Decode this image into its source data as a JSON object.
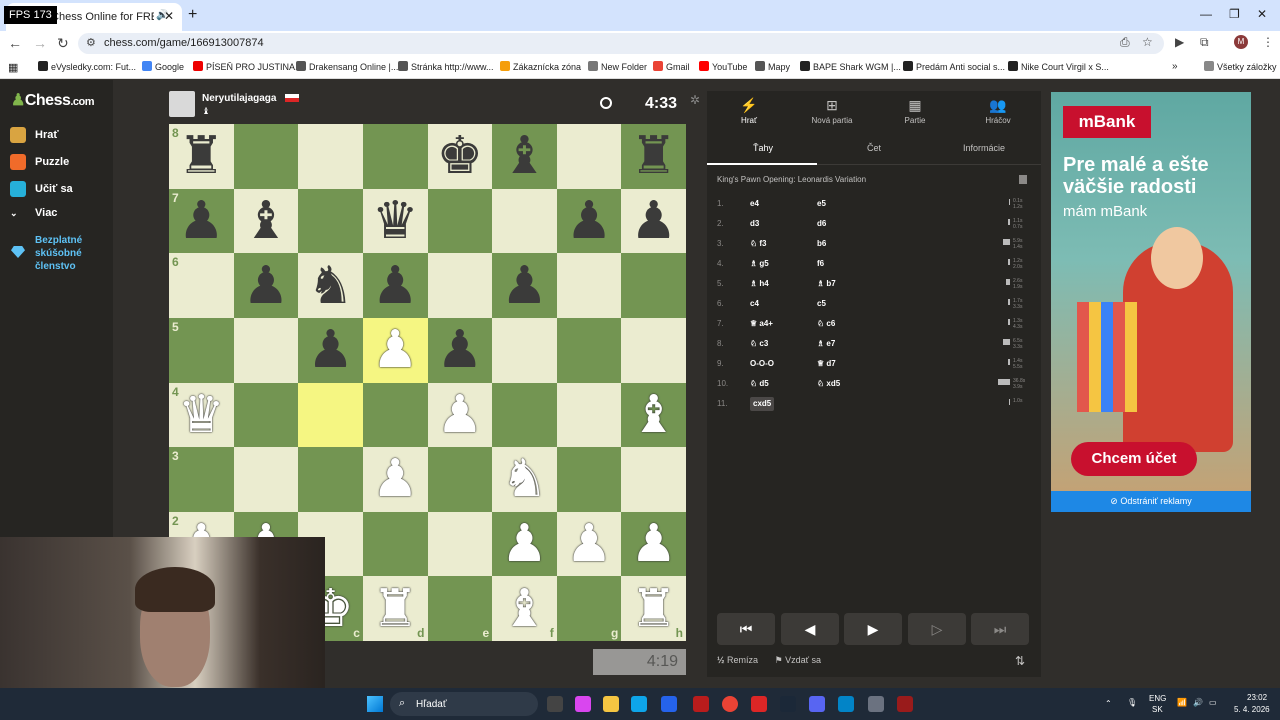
{
  "fps": "FPS 173",
  "browser": {
    "tab_title": "lay Chess Online for FREE",
    "url": "chess.com/game/166913007874",
    "bookmarks": [
      "eVysledky.com: Fut...",
      "Google",
      "PÍSEŇ PRO JUSTINA...",
      "Drakensang Online |...",
      "Stránka http://www...",
      "Zákaznícka zóna",
      "New Folder",
      "Gmail",
      "YouTube",
      "Mapy",
      "BAPE Shark WGM |...",
      "Predám Anti social s...",
      "Nike Court Virgil x S..."
    ],
    "all_bookmarks": "Všetky záložky"
  },
  "sidebar": {
    "logo": "Chess",
    "logo_suffix": ".com",
    "items": [
      "Hrať",
      "Puzzle",
      "Učiť sa",
      "Viac"
    ],
    "promo": "Bezplatné skúšobné členstvo"
  },
  "game": {
    "top_player": "Neryutilajagaga",
    "top_clock": "4:33",
    "bottom_clock": "4:19",
    "pieces": [
      [
        "bR",
        "",
        "",
        "",
        "bK",
        "bB",
        "",
        "bR"
      ],
      [
        "bP",
        "bB",
        "",
        "bQ",
        "",
        "",
        "bP",
        "bP"
      ],
      [
        "",
        "bP",
        "bN",
        "bP",
        "",
        "bP",
        "",
        ""
      ],
      [
        "",
        "",
        "bP",
        "wP",
        "bP",
        "",
        "",
        ""
      ],
      [
        "wQ",
        "",
        "",
        "",
        "wP",
        "",
        "",
        "wB"
      ],
      [
        "",
        "",
        "",
        "wP",
        "",
        "wN",
        "",
        ""
      ],
      [
        "wP",
        "wP",
        "",
        "",
        "",
        "wP",
        "wP",
        "wP"
      ],
      [
        "",
        "",
        "wK",
        "wR",
        "",
        "wB",
        "",
        "wR"
      ]
    ],
    "ranks": [
      "8",
      "7",
      "6",
      "5",
      "4",
      "3",
      "2",
      "1"
    ],
    "files": [
      "a",
      "b",
      "c",
      "d",
      "e",
      "f",
      "g",
      "h"
    ],
    "highlight": [
      "d5",
      "c4"
    ]
  },
  "panel": {
    "tabs": [
      "Hrať",
      "Nová partia",
      "Partie",
      "Hráčov"
    ],
    "subtabs": [
      "Ťahy",
      "Čet",
      "Informácie"
    ],
    "opening": "King's Pawn Opening: Leonardis Variation",
    "moves": [
      {
        "n": "1.",
        "w": "e4",
        "b": "e5",
        "t": [
          "0.1s",
          "1.2s"
        ],
        "wb": 0.1,
        "bb": 0.2
      },
      {
        "n": "2.",
        "w": "d3",
        "b": "d6",
        "t": [
          "1.1s",
          "0.7s"
        ],
        "wb": 0.15,
        "bb": 0.1
      },
      {
        "n": "3.",
        "w": "♘ f3",
        "b": "b6",
        "t": [
          "5.9s",
          "1.4s"
        ],
        "wb": 0.6,
        "bb": 0.15
      },
      {
        "n": "4.",
        "w": "♗ g5",
        "b": "f6",
        "t": [
          "1.2s",
          "2.0s"
        ],
        "wb": 0.15,
        "bb": 0.2
      },
      {
        "n": "5.",
        "w": "♗ h4",
        "b": "♗ b7",
        "t": [
          "2.6s",
          "1.9s"
        ],
        "wb": 0.3,
        "bb": 0.2
      },
      {
        "n": "6.",
        "w": "c4",
        "b": "c5",
        "t": [
          "1.7s",
          "3.3s"
        ],
        "wb": 0.2,
        "bb": 0.3
      },
      {
        "n": "7.",
        "w": "♕ a4+",
        "b": "♘ c6",
        "t": [
          "1.3s",
          "4.3s"
        ],
        "wb": 0.15,
        "bb": 0.4
      },
      {
        "n": "8.",
        "w": "♘ c3",
        "b": "♗ e7",
        "t": [
          "6.5s",
          "3.3s"
        ],
        "wb": 0.6,
        "bb": 0.3
      },
      {
        "n": "9.",
        "w": "O-O-O",
        "b": "♕ d7",
        "t": [
          "1.4s",
          "5.5s"
        ],
        "wb": 0.15,
        "bb": 0.5
      },
      {
        "n": "10.",
        "w": "♘ d5",
        "b": "♘ xd5",
        "t": [
          "36.8s",
          "3.9s"
        ],
        "wb": 1.0,
        "bb": 0.35
      },
      {
        "n": "11.",
        "w": "cxd5",
        "b": "",
        "t": [
          "1.0s",
          ""
        ],
        "wb": 0.1,
        "bb": 0
      }
    ],
    "draw": "Remíza",
    "resign": "Vzdať sa"
  },
  "ad": {
    "brand": "mBank",
    "headline": "Pre malé a ešte väčšie radosti",
    "sub": "mám mBank",
    "cta": "Chcem účet",
    "remove": "Odstrániť reklamy"
  },
  "taskbar": {
    "search": "Hľadať",
    "lang1": "ENG",
    "lang2": "SK",
    "time": "23:02",
    "date": "5. 4. 2026"
  }
}
